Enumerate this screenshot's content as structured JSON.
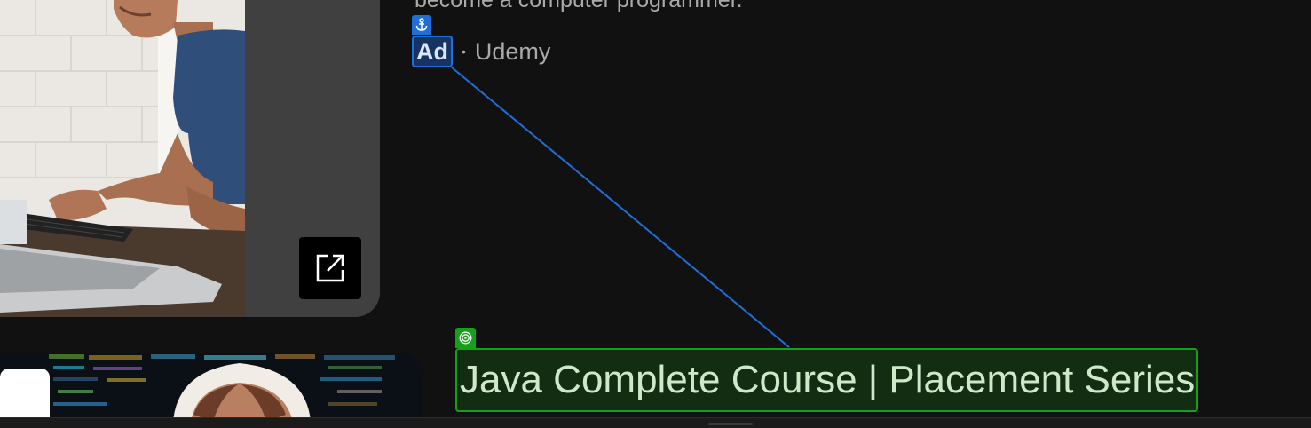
{
  "ad": {
    "description": "become a computer programmer.",
    "badge_label": "Ad",
    "separator": "•",
    "advertiser": "Udemy",
    "icons": {
      "open_external": "open-in-new-icon",
      "anchor": "anchor-icon"
    }
  },
  "next_video": {
    "title": "Java Complete Course | Placement Series",
    "icons": {
      "target": "target-icon"
    }
  },
  "colors": {
    "background": "#111111",
    "ad_highlight": "#1e6fd9",
    "target_highlight": "#14a01a",
    "secondary_text": "#aaaaaa"
  }
}
